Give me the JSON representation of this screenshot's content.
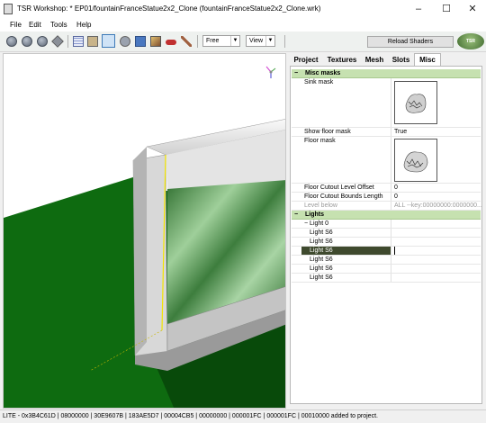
{
  "window": {
    "title": "TSR Workshop: * EP01/fountainFranceStatue2x2_Clone (fountainFranceStatue2x2_Clone.wrk)",
    "controls": [
      "–",
      "☐",
      "✕"
    ]
  },
  "menu": [
    "File",
    "Edit",
    "Tools",
    "Help"
  ],
  "toolbar": {
    "camera_mode": "Free",
    "view_label": "View",
    "reload_label": "Reload Shaders",
    "logo_text": "TSR Workshop"
  },
  "tabs": [
    {
      "label": "Project",
      "active": false
    },
    {
      "label": "Textures",
      "active": false
    },
    {
      "label": "Mesh",
      "active": false
    },
    {
      "label": "Slots",
      "active": false
    },
    {
      "label": "Misc",
      "active": true
    }
  ],
  "misc_masks": {
    "header": "Misc masks",
    "sink_mask_label": "Sink mask",
    "show_floor_mask": {
      "name": "Show floor mask",
      "value": "True"
    },
    "floor_mask_label": "Floor mask",
    "floor_cutout_level_offset": {
      "name": "Floor Cutout Level Offset",
      "value": "0"
    },
    "floor_cutout_bounds_length": {
      "name": "Floor Cutout Bounds Length",
      "value": "0"
    },
    "level_below": {
      "name": "Level below",
      "value": "ALL --key:00000000:0000000..."
    }
  },
  "lights": {
    "header": "Lights",
    "group_label": "Light 0",
    "items": [
      "Light S6",
      "Light S6",
      "Light S6",
      "Light S6",
      "Light S6",
      "Light S6"
    ],
    "selected_index": 2
  },
  "status": {
    "text": "LITE - 0x3B4C61D | 08000000 | 30E9607B | 183AE5D7 | 00004CB5 | 00000000 | 000001FC | 000001FC | 00010000 added to project."
  },
  "colors": {
    "category_header": "#c6e1b0",
    "selected_row": "#3f4a2e",
    "floor_green": "#0e6b10",
    "water_green": "#3a7a3a"
  }
}
